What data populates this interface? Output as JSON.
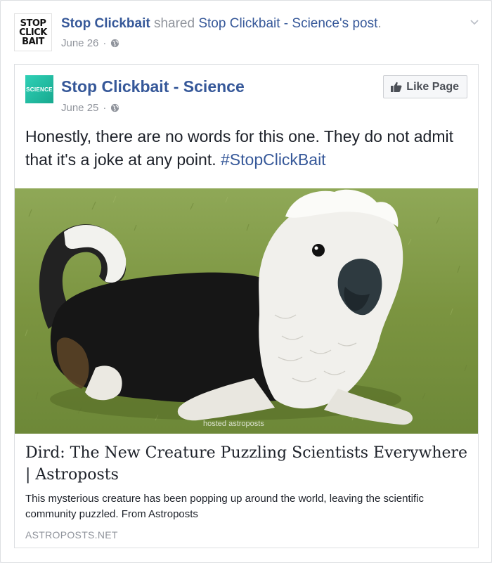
{
  "post": {
    "sharer_logo_lines": [
      "STOP",
      "CLICK",
      "BAIT"
    ],
    "sharer_name": "Stop Clickbait",
    "shared_word": "shared",
    "shared_page": "Stop Clickbait - Science",
    "shared_suffix": "'s",
    "shared_object": "post",
    "shared_dot": ".",
    "date": "June 26",
    "date_sep": "·"
  },
  "inner_post": {
    "page_logo_text": "SCIENCE",
    "page_name": "Stop Clickbait - Science",
    "date": "June 25",
    "date_sep": "·",
    "like_button_label": "Like Page",
    "text": "Honestly, there are no words for this one. They do not admit that it's a joke at any point. ",
    "hashtag": "#StopClickBait",
    "image_watermark": "hosted astroposts"
  },
  "link_preview": {
    "title": "Dird: The New Creature Puzzling Scientists Everywhere | Astroposts",
    "description": "This mysterious creature has been popping up around the world, leaving the scientific community puzzled. From Astroposts",
    "domain": "ASTROPOSTS.NET"
  },
  "colors": {
    "link_blue": "#365899",
    "meta_gray": "#90949c",
    "page_bg": "#e9ebee"
  },
  "icons": [
    "globe-icon",
    "chevron-down-icon",
    "like-thumb-icon"
  ]
}
